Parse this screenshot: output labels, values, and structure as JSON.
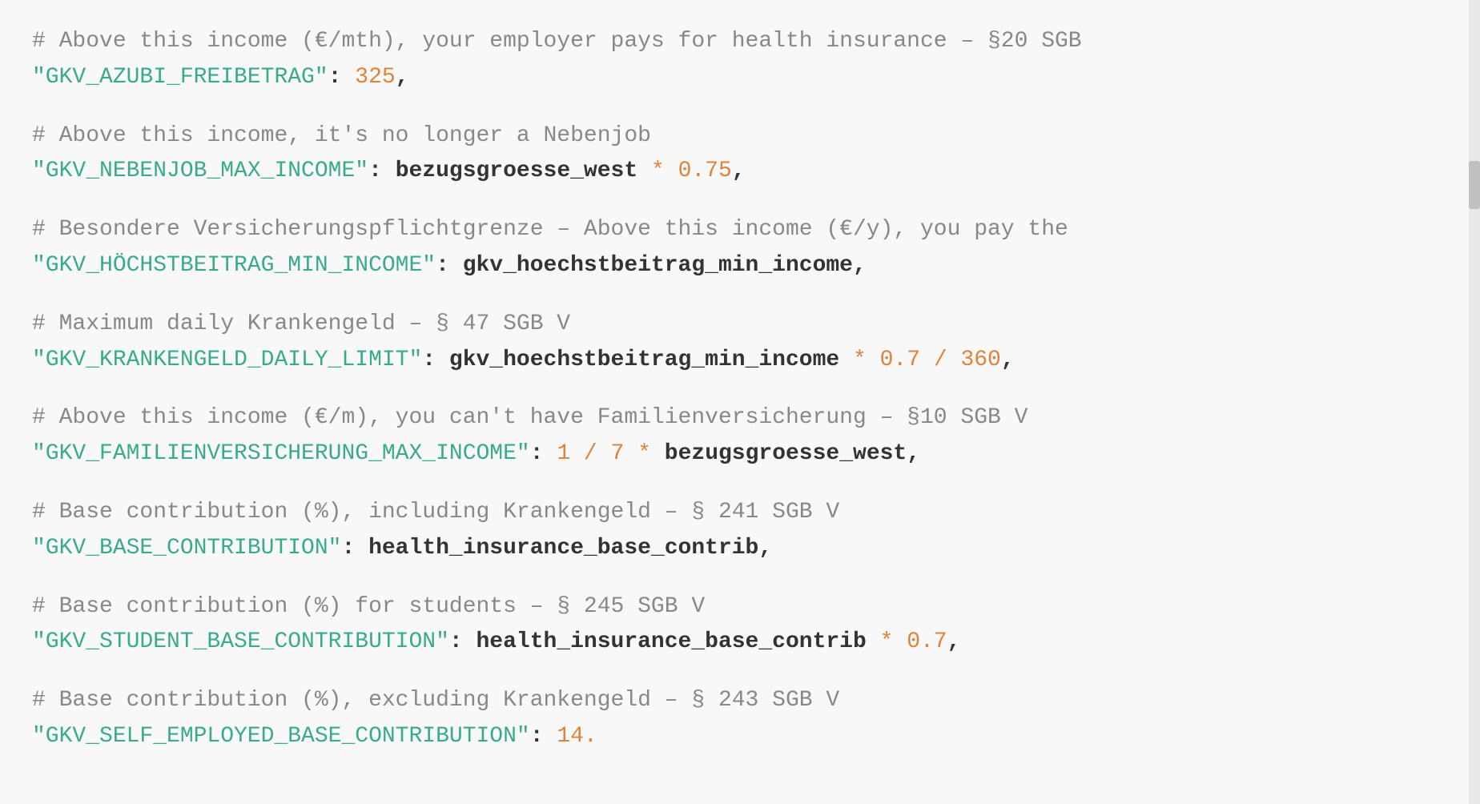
{
  "lines": [
    {
      "type": "comment",
      "text": "# Above this income (€/mth), your employer pays for health insurance – §20 SGB"
    },
    {
      "type": "code",
      "key": "\"GKV_AZUBI_FREIBETRAG\"",
      "colon": ":",
      "space": " ",
      "value_parts": [
        {
          "text": "325",
          "class": "value-number"
        },
        {
          "text": ",",
          "class": "punctuation"
        }
      ]
    },
    {
      "type": "empty"
    },
    {
      "type": "comment",
      "text": "# Above this income, it's no longer a Nebenjob"
    },
    {
      "type": "code",
      "key": "\"GKV_NEBENJOB_MAX_INCOME\"",
      "colon": ":",
      "space": " ",
      "value_parts": [
        {
          "text": "bezugsgroesse_west",
          "class": "value-plain"
        },
        {
          "text": " * ",
          "class": "operator"
        },
        {
          "text": "0.75",
          "class": "value-number"
        },
        {
          "text": ",",
          "class": "punctuation"
        }
      ]
    },
    {
      "type": "empty"
    },
    {
      "type": "comment",
      "text": "# Besondere Versicherungspflichtgrenze – Above this income (€/y), you pay the"
    },
    {
      "type": "code",
      "key": "\"GKV_HÖCHSTBEITRAG_MIN_INCOME\"",
      "colon": ":",
      "space": " ",
      "value_parts": [
        {
          "text": "gkv_hoechstbeitrag_min_income",
          "class": "value-plain"
        },
        {
          "text": ",",
          "class": "punctuation"
        }
      ]
    },
    {
      "type": "empty"
    },
    {
      "type": "comment",
      "text": "# Maximum daily Krankengeld – § 47 SGB V"
    },
    {
      "type": "code",
      "key": "\"GKV_KRANKENGELD_DAILY_LIMIT\"",
      "colon": ":",
      "space": " ",
      "value_parts": [
        {
          "text": "gkv_hoechstbeitrag_min_income",
          "class": "value-plain"
        },
        {
          "text": " * ",
          "class": "operator"
        },
        {
          "text": "0.7",
          "class": "value-number"
        },
        {
          "text": " / ",
          "class": "operator"
        },
        {
          "text": "360",
          "class": "value-number"
        },
        {
          "text": ",",
          "class": "punctuation"
        }
      ]
    },
    {
      "type": "empty"
    },
    {
      "type": "comment",
      "text": "# Above this income (€/m), you can't have Familienversicherung – §10 SGB V"
    },
    {
      "type": "code",
      "key": "\"GKV_FAMILIENVERSICHERUNG_MAX_INCOME\"",
      "colon": ":",
      "space": " ",
      "value_parts": [
        {
          "text": "1",
          "class": "value-number"
        },
        {
          "text": " / ",
          "class": "operator"
        },
        {
          "text": "7",
          "class": "value-number"
        },
        {
          "text": " * ",
          "class": "operator"
        },
        {
          "text": "bezugsgroesse_west",
          "class": "value-plain"
        },
        {
          "text": ",",
          "class": "punctuation"
        }
      ]
    },
    {
      "type": "empty"
    },
    {
      "type": "comment",
      "text": "# Base contribution (%), including Krankengeld – § 241 SGB V"
    },
    {
      "type": "code",
      "key": "\"GKV_BASE_CONTRIBUTION\"",
      "colon": ":",
      "space": " ",
      "value_parts": [
        {
          "text": "health_insurance_base_contrib",
          "class": "value-plain"
        },
        {
          "text": ",",
          "class": "punctuation"
        }
      ]
    },
    {
      "type": "empty"
    },
    {
      "type": "comment",
      "text": "# Base contribution (%) for students – § 245 SGB V"
    },
    {
      "type": "code",
      "key": "\"GKV_STUDENT_BASE_CONTRIBUTION\"",
      "colon": ":",
      "space": " ",
      "value_parts": [
        {
          "text": "health_insurance_base_contrib",
          "class": "value-plain"
        },
        {
          "text": " * ",
          "class": "operator"
        },
        {
          "text": "0.7",
          "class": "value-number"
        },
        {
          "text": ",",
          "class": "punctuation"
        }
      ]
    },
    {
      "type": "empty"
    },
    {
      "type": "comment",
      "text": "# Base contribution (%), excluding Krankengeld – § 243 SGB V"
    },
    {
      "type": "code",
      "key": "\"GKV_SELF_EMPLOYED_BASE_CONTRIBUTION\"",
      "colon": ":",
      "space": " ",
      "value_parts": [
        {
          "text": "14.",
          "class": "value-number"
        }
      ]
    }
  ],
  "trailing_text": "the"
}
